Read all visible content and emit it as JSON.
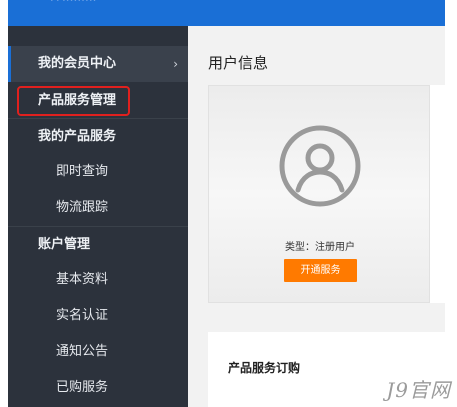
{
  "topbar": {
    "brand_text": "• • •••••••••"
  },
  "sidebar": {
    "member_center": {
      "label": "我的会员中心",
      "chevron": "›"
    },
    "product_service_mgmt": {
      "label": "产品服务管理"
    },
    "my_products": {
      "label": "我的产品服务"
    },
    "instant_query": {
      "label": "即时查询"
    },
    "logistics_tracking": {
      "label": "物流跟踪"
    },
    "account_mgmt": {
      "label": "账户管理"
    },
    "basic_info": {
      "label": "基本资料"
    },
    "real_name": {
      "label": "实名认证"
    },
    "notices": {
      "label": "通知公告"
    },
    "purchased": {
      "label": "已购服务"
    }
  },
  "main": {
    "title": "用户信息",
    "user_card": {
      "avatar_icon": "user-avatar-icon",
      "type_text": "类型：注册用户",
      "open_service_label": "开通服务"
    },
    "order_panel": {
      "title": "产品服务订购"
    }
  },
  "watermark": "J9官网",
  "colors": {
    "topbar": "#1a6fd6",
    "sidebar": "#2c323c",
    "accent_button": "#ff7a00",
    "highlight_border": "#e0201e"
  }
}
